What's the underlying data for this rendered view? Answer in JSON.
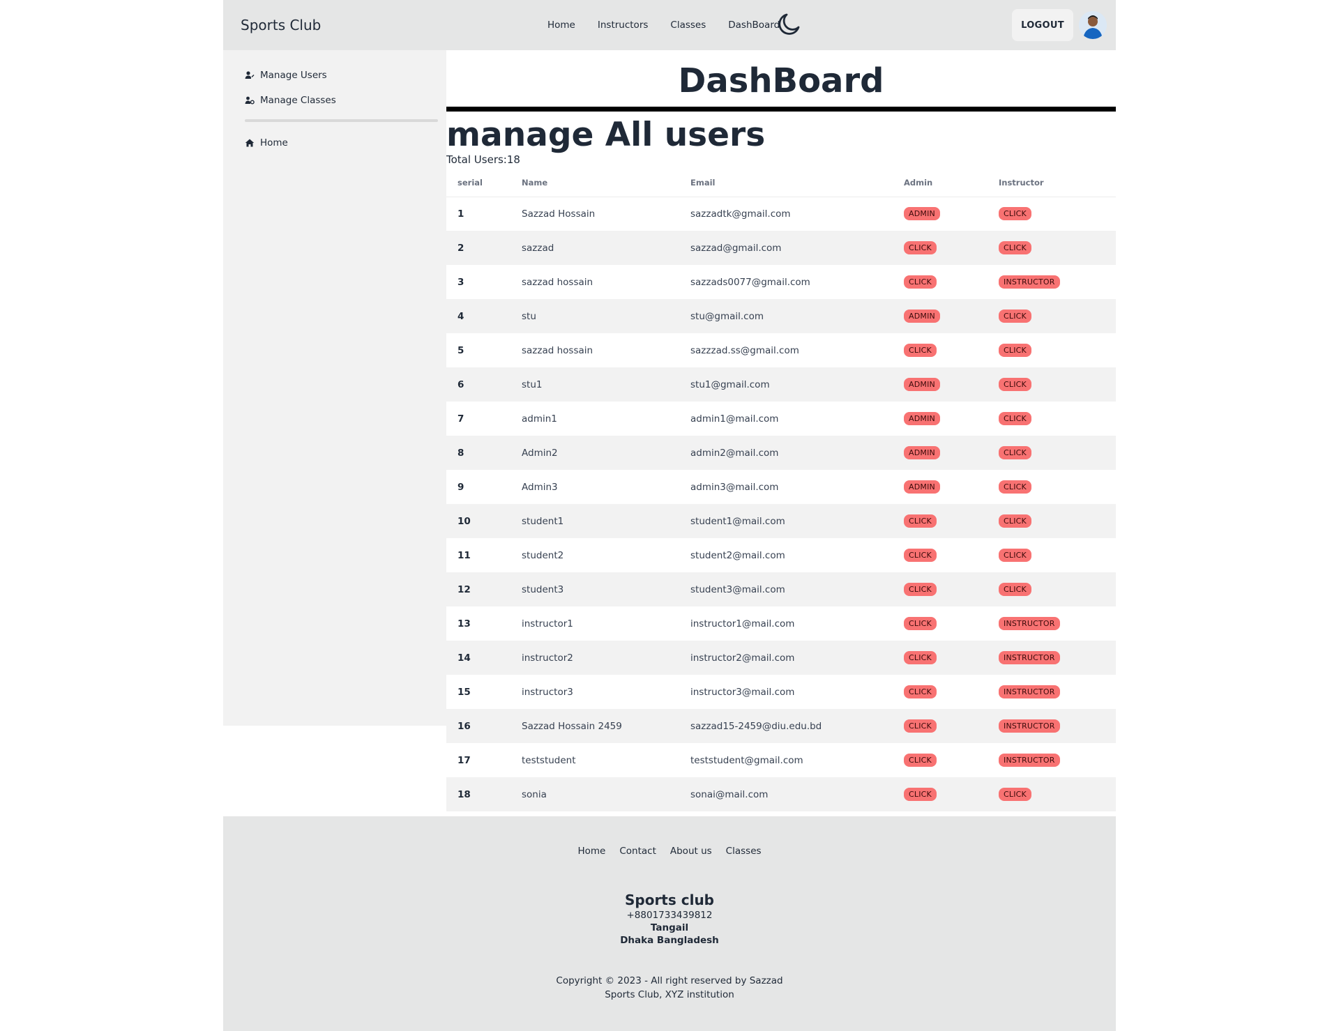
{
  "navbar": {
    "brand": "Sports Club",
    "links": [
      "Home",
      "Instructors",
      "Classes",
      "DashBoard"
    ],
    "logout_label": "LOGOUT"
  },
  "sidebar": {
    "items": [
      {
        "label": "Manage Users",
        "icon": "user-pen-icon"
      },
      {
        "label": "Manage Classes",
        "icon": "users-gear-icon"
      }
    ],
    "home_label": "Home"
  },
  "main": {
    "title": "DashBoard",
    "section_title": "manage All users",
    "total_users": "Total Users:18",
    "columns": [
      "serial",
      "Name",
      "Email",
      "Admin",
      "Instructor"
    ],
    "rows": [
      {
        "serial": "1",
        "name": "Sazzad Hossain",
        "email": "sazzadtk@gmail.com",
        "admin": "ADMIN",
        "instructor": "CLICK"
      },
      {
        "serial": "2",
        "name": "sazzad",
        "email": "sazzad@gmail.com",
        "admin": "CLICK",
        "instructor": "CLICK"
      },
      {
        "serial": "3",
        "name": "sazzad hossain",
        "email": "sazzads0077@gmail.com",
        "admin": "CLICK",
        "instructor": "INSTRUCTOR"
      },
      {
        "serial": "4",
        "name": "stu",
        "email": "stu@gmail.com",
        "admin": "ADMIN",
        "instructor": "CLICK"
      },
      {
        "serial": "5",
        "name": "sazzad hossain",
        "email": "sazzzad.ss@gmail.com",
        "admin": "CLICK",
        "instructor": "CLICK"
      },
      {
        "serial": "6",
        "name": "stu1",
        "email": "stu1@gmail.com",
        "admin": "ADMIN",
        "instructor": "CLICK"
      },
      {
        "serial": "7",
        "name": "admin1",
        "email": "admin1@mail.com",
        "admin": "ADMIN",
        "instructor": "CLICK"
      },
      {
        "serial": "8",
        "name": "Admin2",
        "email": "admin2@mail.com",
        "admin": "ADMIN",
        "instructor": "CLICK"
      },
      {
        "serial": "9",
        "name": "Admin3",
        "email": "admin3@mail.com",
        "admin": "ADMIN",
        "instructor": "CLICK"
      },
      {
        "serial": "10",
        "name": "student1",
        "email": "student1@mail.com",
        "admin": "CLICK",
        "instructor": "CLICK"
      },
      {
        "serial": "11",
        "name": "student2",
        "email": "student2@mail.com",
        "admin": "CLICK",
        "instructor": "CLICK"
      },
      {
        "serial": "12",
        "name": "student3",
        "email": "student3@mail.com",
        "admin": "CLICK",
        "instructor": "CLICK"
      },
      {
        "serial": "13",
        "name": "instructor1",
        "email": "instructor1@mail.com",
        "admin": "CLICK",
        "instructor": "INSTRUCTOR"
      },
      {
        "serial": "14",
        "name": "instructor2",
        "email": "instructor2@mail.com",
        "admin": "CLICK",
        "instructor": "INSTRUCTOR"
      },
      {
        "serial": "15",
        "name": "instructor3",
        "email": "instructor3@mail.com",
        "admin": "CLICK",
        "instructor": "INSTRUCTOR"
      },
      {
        "serial": "16",
        "name": "Sazzad Hossain 2459",
        "email": "sazzad15-2459@diu.edu.bd",
        "admin": "CLICK",
        "instructor": "INSTRUCTOR"
      },
      {
        "serial": "17",
        "name": "teststudent",
        "email": "teststudent@gmail.com",
        "admin": "CLICK",
        "instructor": "INSTRUCTOR"
      },
      {
        "serial": "18",
        "name": "sonia",
        "email": "sonai@mail.com",
        "admin": "CLICK",
        "instructor": "CLICK"
      }
    ]
  },
  "footer": {
    "links": [
      "Home",
      "Contact",
      "About us",
      "Classes"
    ],
    "brand": "Sports club",
    "phone": "+8801733439812",
    "city": "Tangail",
    "region": "Dhaka Bangladesh",
    "copyright_line1": "Copyright © 2023 - All right reserved by Sazzad",
    "copyright_line2": "Sports Club, XYZ institution"
  },
  "colors": {
    "navbar_bg": "#e5e6e6",
    "sidebar_bg": "#f2f2f2",
    "badge_bg": "#f87272",
    "stripe_bg": "#f2f2f2"
  }
}
